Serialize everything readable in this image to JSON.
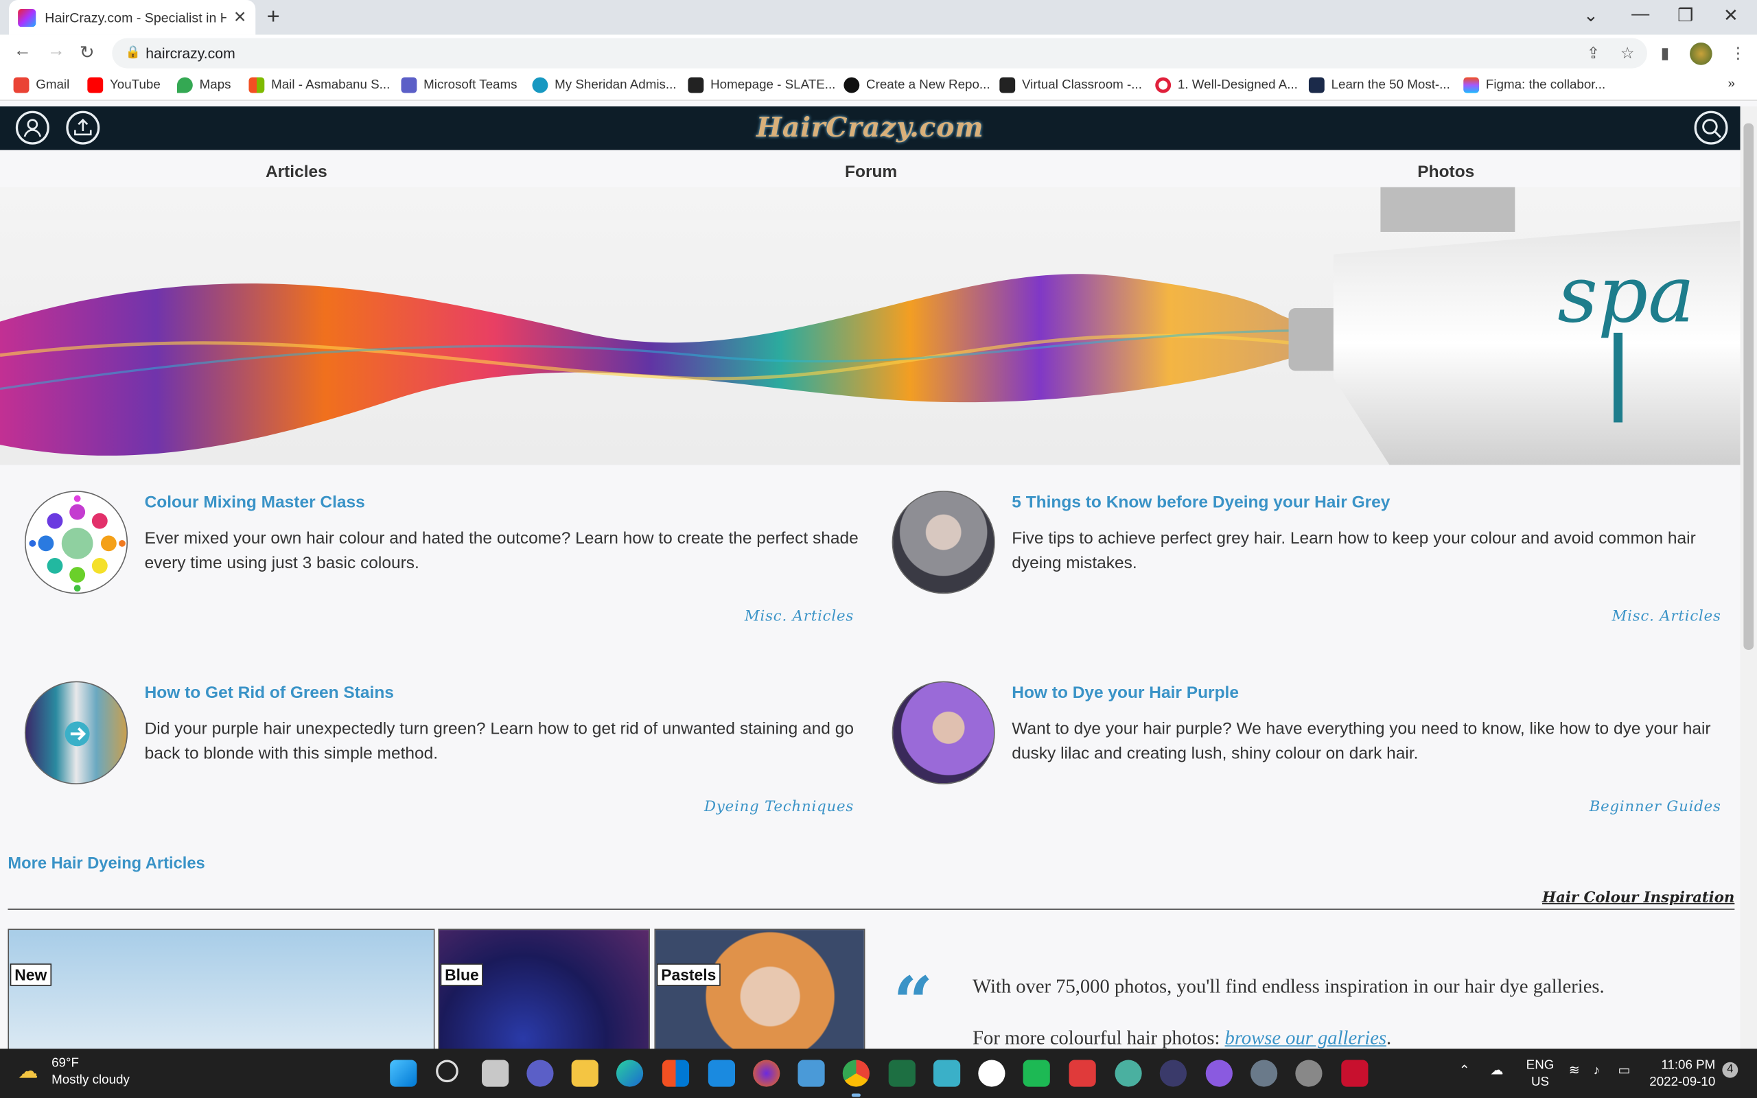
{
  "browser": {
    "tab_title": "HairCrazy.com - Specialist in Hair",
    "url": "haircrazy.com",
    "bookmarks": [
      "Gmail",
      "YouTube",
      "Maps",
      "Mail - Asmabanu S...",
      "Microsoft Teams",
      "My Sheridan Admis...",
      "Homepage - SLATE...",
      "Create a New Repo...",
      "Virtual Classroom -...",
      "1. Well-Designed A...",
      "Learn the 50 Most-...",
      "Figma: the collabor..."
    ]
  },
  "site": {
    "logo": "HairCrazy.com",
    "nav": [
      "Articles",
      "Forum",
      "Photos"
    ]
  },
  "articles": [
    {
      "title": "Colour Mixing Master Class",
      "desc": "Ever mixed your own hair colour and hated the outcome? Learn how to create the perfect shade every time using just 3 basic colours.",
      "category": "Misc. Articles"
    },
    {
      "title": "5 Things to Know before Dyeing your Hair Grey",
      "desc": "Five tips to achieve perfect grey hair. Learn how to keep your colour and avoid common hair dyeing mistakes.",
      "category": "Misc. Articles"
    },
    {
      "title": "How to Get Rid of Green Stains",
      "desc": "Did your purple hair unexpectedly turn green? Learn how to get rid of unwanted staining and go back to blonde with this simple method.",
      "category": "Dyeing Techniques"
    },
    {
      "title": "How to Dye your Hair Purple",
      "desc": "Want to dye your hair purple? We have everything you need to know, like how to dye your hair dusky lilac and creating lush, shiny colour on dark hair.",
      "category": "Beginner Guides"
    }
  ],
  "more_link": "More Hair Dyeing Articles",
  "inspiration_heading": "Hair Colour Inspiration",
  "photo_labels": [
    "New",
    "Blue",
    "Pastels"
  ],
  "quote": {
    "line1": "With over 75,000 photos, you'll find endless inspiration in our hair dye galleries.",
    "line2_prefix": "For more colourful hair photos: ",
    "line2_link": "browse our galleries",
    "line2_suffix": "."
  },
  "taskbar": {
    "temp": "69°F",
    "weather": "Mostly cloudy",
    "lang1": "ENG",
    "lang2": "US",
    "time": "11:06 PM",
    "date": "2022-09-10",
    "notif_count": "4"
  },
  "colors": {
    "header_bg": "#0d1d28",
    "link_blue": "#3a93c7",
    "taskbar_bg": "#202020"
  }
}
